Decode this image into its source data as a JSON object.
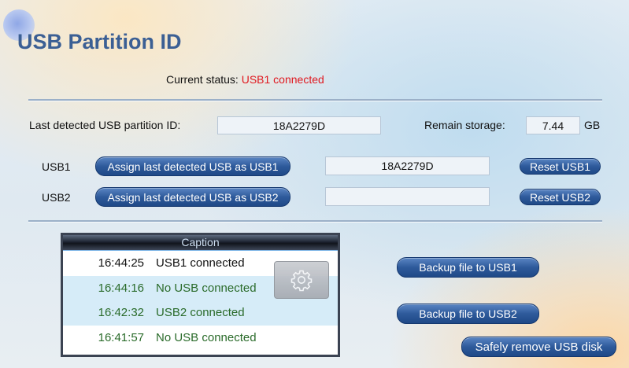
{
  "title": "USB Partition ID",
  "status": {
    "label": "Current status:",
    "value": "USB1 connected"
  },
  "detected": {
    "label": "Last detected USB partition ID:",
    "value": "18A2279D"
  },
  "storage": {
    "label": "Remain storage:",
    "value": "7.44",
    "unit": "GB"
  },
  "usb1": {
    "label": "USB1",
    "assign_label": "Assign last detected USB as USB1",
    "value": "18A2279D",
    "reset_label": "Reset USB1"
  },
  "usb2": {
    "label": "USB2",
    "assign_label": "Assign last detected USB as USB2",
    "value": "",
    "reset_label": "Reset USB2"
  },
  "caption": {
    "title": "Caption",
    "rows": [
      {
        "time": "16:44:25",
        "message": "USB1 connected"
      },
      {
        "time": "16:44:16",
        "message": "No USB connected"
      },
      {
        "time": "16:42:32",
        "message": "USB2 connected"
      },
      {
        "time": "16:41:57",
        "message": "No USB connected"
      }
    ],
    "settings_icon": "gear-icon"
  },
  "actions": {
    "backup_usb1": "Backup file to USB1",
    "backup_usb2": "Backup file to USB2",
    "safely_remove": "Safely remove USB disk"
  },
  "colors": {
    "title": "#3b5f94",
    "status_value": "#e0181f",
    "button": "#2e5a9b",
    "row_alt": "#d6ecf8",
    "row_alt_text": "#2a6b2a"
  }
}
